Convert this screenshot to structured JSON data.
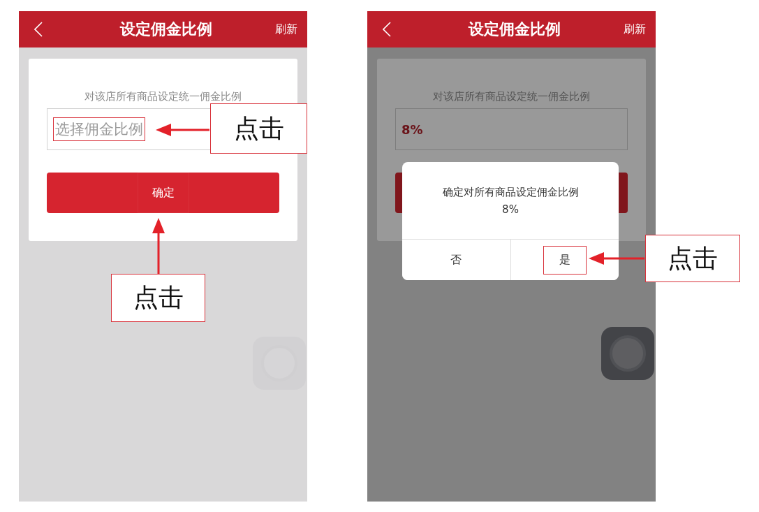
{
  "screens": [
    {
      "header": {
        "title": "设定佣金比例",
        "action": "刷新"
      },
      "instruction": "对该店所有商品设定统一佣金比例",
      "field": {
        "placeholder": "选择佣金比例"
      },
      "confirm_button": "确定",
      "dimmed": false,
      "callouts": [
        {
          "label": "点击",
          "kind": "field"
        },
        {
          "label": "点击",
          "kind": "confirm"
        }
      ]
    },
    {
      "header": {
        "title": "设定佣金比例",
        "action": "刷新"
      },
      "instruction": "对该店所有商品设定统一佣金比例",
      "field": {
        "value": "8%"
      },
      "dimmed": true,
      "dialog": {
        "message": "确定对所有商品设定佣金比例",
        "value": "8%",
        "buttons": [
          {
            "label": "否"
          },
          {
            "label": "是"
          }
        ]
      },
      "callouts": [
        {
          "label": "点击",
          "kind": "dialog_yes"
        }
      ]
    }
  ]
}
